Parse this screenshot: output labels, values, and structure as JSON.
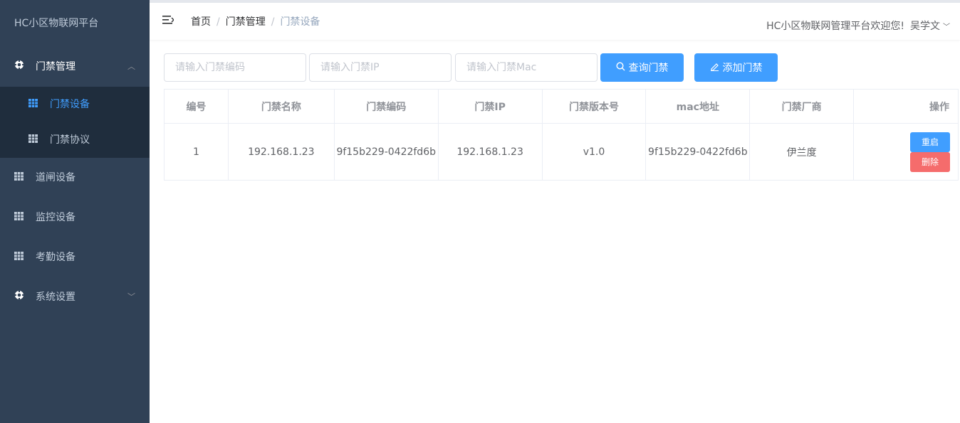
{
  "sidebar": {
    "brand": "HC小区物联网平台",
    "groups": [
      {
        "label": "门禁管理",
        "icon": "gear-icon",
        "expanded": true,
        "items": [
          {
            "label": "门禁设备",
            "icon": "grid-icon",
            "active": true
          },
          {
            "label": "门禁协议",
            "icon": "grid-icon",
            "active": false
          }
        ]
      },
      {
        "label": "道闸设备",
        "icon": "grid-icon"
      },
      {
        "label": "监控设备",
        "icon": "grid-icon"
      },
      {
        "label": "考勤设备",
        "icon": "grid-icon"
      },
      {
        "label": "系统设置",
        "icon": "gear-icon",
        "expanded": false
      }
    ]
  },
  "header": {
    "breadcrumb": [
      "首页",
      "门禁管理",
      "门禁设备"
    ],
    "welcome": "HC小区物联网管理平台欢迎您!",
    "user": "吴学文"
  },
  "toolbar": {
    "code_placeholder": "请输入门禁编码",
    "ip_placeholder": "请输入门禁IP",
    "mac_placeholder": "请输入门禁Mac",
    "query_label": "查询门禁",
    "add_label": "添加门禁"
  },
  "table": {
    "columns": [
      "编号",
      "门禁名称",
      "门禁编码",
      "门禁IP",
      "门禁版本号",
      "mac地址",
      "门禁厂商",
      "操作"
    ],
    "rows": [
      {
        "id": "1",
        "name": "192.168.1.23",
        "code": "9f15b229-0422fd6b",
        "ip": "192.168.1.23",
        "version": "v1.0",
        "mac": "9f15b229-0422fd6b",
        "vendor": "伊兰度",
        "actions": {
          "restart": "重启",
          "delete": "删除"
        }
      }
    ]
  },
  "colors": {
    "sidebar_bg": "#304156",
    "submenu_bg": "#1f2d3d",
    "primary": "#409eff",
    "danger": "#f56c6c"
  }
}
